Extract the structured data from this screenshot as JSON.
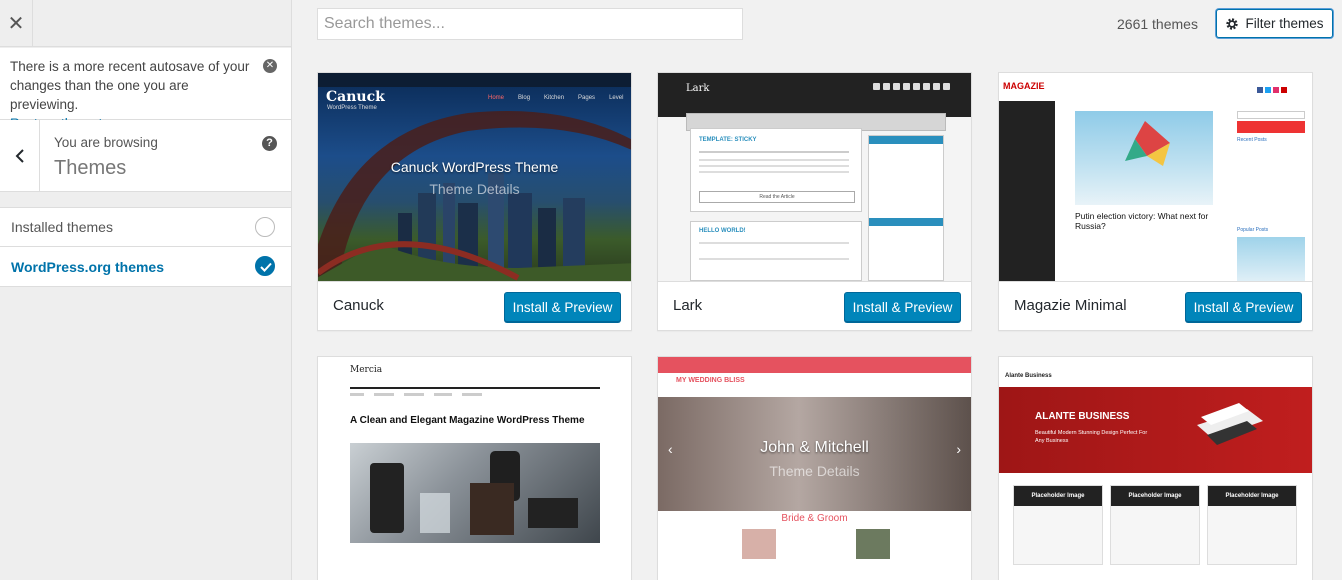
{
  "sidebar": {
    "close_label": "✕",
    "notice": {
      "text": "There is a more recent autosave of your changes than the one you are previewing.",
      "link": "Restore the autosave"
    },
    "browsing_label": "You are browsing",
    "browsing_title": "Themes",
    "sources": [
      {
        "label": "Installed themes",
        "checked": false
      },
      {
        "label": "WordPress.org themes",
        "checked": true
      }
    ]
  },
  "toolbar": {
    "search_placeholder": "Search themes...",
    "count": "2661 themes",
    "filter_label": "Filter themes"
  },
  "themes": [
    {
      "name": "Canuck",
      "install_label": "Install & Preview",
      "overlay": "Canuck WordPress Theme",
      "details": "Theme Details",
      "logo": "Canuck",
      "logo_sub": "WordPress Theme"
    },
    {
      "name": "Lark",
      "install_label": "Install & Preview",
      "logo": "Lark",
      "post1": "TEMPLATE: STICKY",
      "post2": "HELLO WORLD!",
      "read_more": "Read the Article"
    },
    {
      "name": "Magazie Minimal",
      "install_label": "Install & Preview",
      "logo": "MAGAZIE",
      "headline": "Putin election victory: What next for Russia?",
      "recent": "Recent Posts",
      "popular": "Popular Posts"
    },
    {
      "name": "Mercia",
      "logo": "Mercia",
      "headline": "A Clean and Elegant Magazine WordPress Theme"
    },
    {
      "name": "My Wedding Bliss",
      "logo": "MY WEDDING BLISS",
      "overlay": "John & Mitchell",
      "details": "Theme Details",
      "caption": "Bride & Groom"
    },
    {
      "name": "Alante Business",
      "logo": "Alante Business",
      "hero": "ALANTE BUSINESS",
      "hero_sub": "Beautiful Modern Stunning Design Perfect For Any Business",
      "placeholder": "Placeholder Image"
    }
  ],
  "colors": {
    "accent": "#0073aa",
    "button": "#0085ba"
  }
}
